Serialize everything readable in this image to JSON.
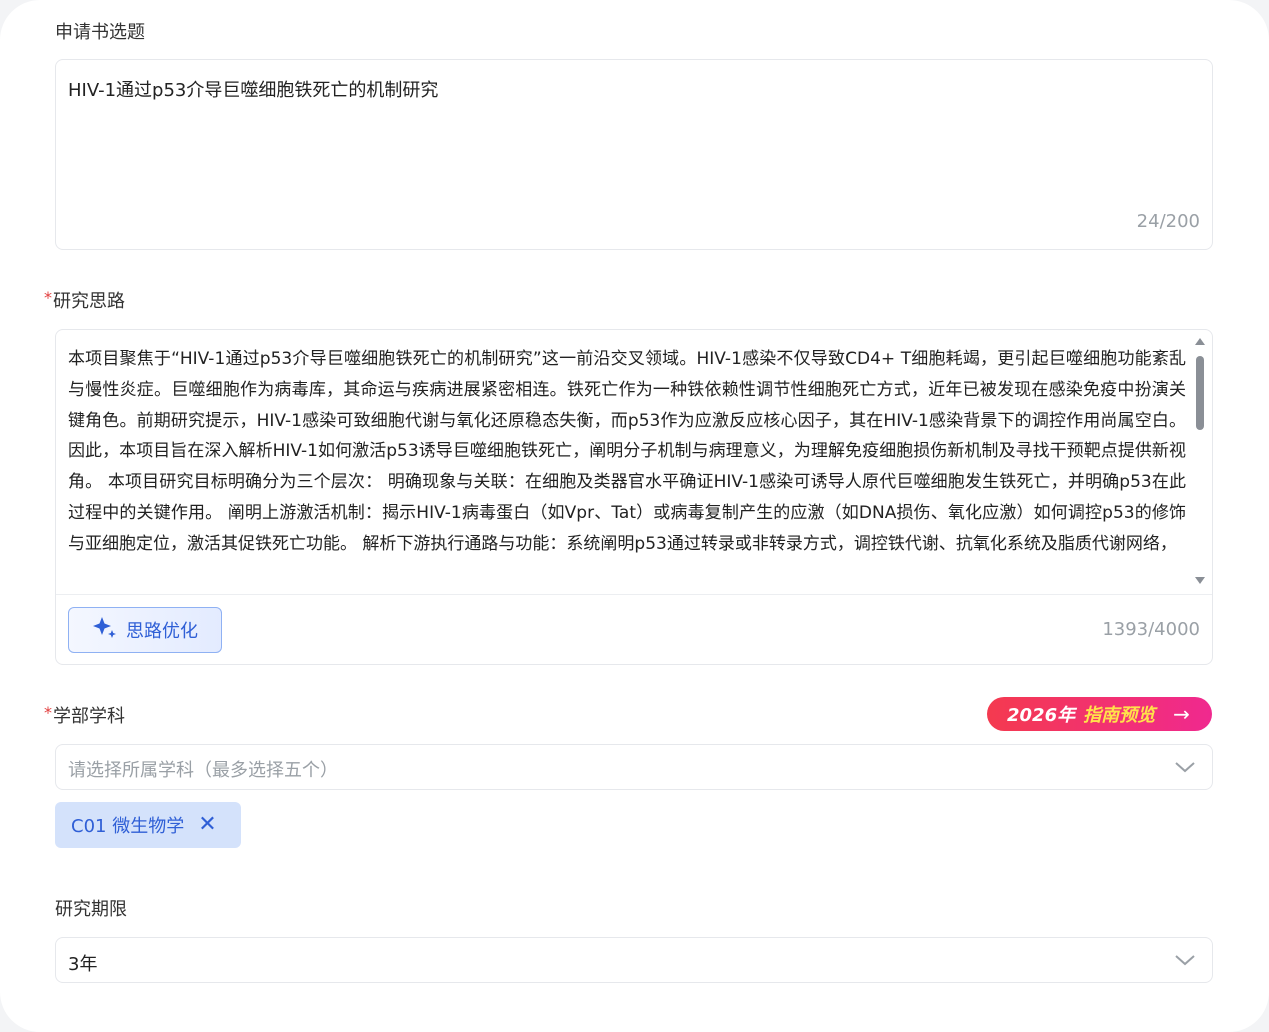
{
  "title_section": {
    "label": "申请书选题",
    "value": "HIV-1通过p53介导巨噬细胞铁死亡的机制研究",
    "counter": "24/200"
  },
  "research_idea": {
    "required_mark": "*",
    "label": "研究思路",
    "text": "本项目聚焦于“HIV-1通过p53介导巨噬细胞铁死亡的机制研究”这一前沿交叉领域。HIV-1感染不仅导致CD4+ T细胞耗竭，更引起巨噬细胞功能紊乱与慢性炎症。巨噬细胞作为病毒库，其命运与疾病进展紧密相连。铁死亡作为一种铁依赖性调节性细胞死亡方式，近年已被发现在感染免疫中扮演关键角色。前期研究提示，HIV-1感染可致细胞代谢与氧化还原稳态失衡，而p53作为应激反应核心因子，其在HIV-1感染背景下的调控作用尚属空白。因此，本项目旨在深入解析HIV-1如何激活p53诱导巨噬细胞铁死亡，阐明分子机制与病理意义，为理解免疫细胞损伤新机制及寻找干预靶点提供新视角。 本项目研究目标明确分为三个层次： 明确现象与关联：在细胞及类器官水平确证HIV-1感染可诱导人原代巨噬细胞发生铁死亡，并明确p53在此过程中的关键作用。 阐明上游激活机制：揭示HIV-1病毒蛋白（如Vpr、Tat）或病毒复制产生的应激（如DNA损伤、氧化应激）如何调控p53的修饰与亚细胞定位，激活其促铁死亡功能。 解析下游执行通路与功能：系统阐明p53通过转录或非转录方式，调控铁代谢、抗氧化系统及脂质代谢网络，",
    "optimize_button": "思路优化",
    "counter": "1393/4000"
  },
  "discipline": {
    "required_mark": "*",
    "label": "学部学科",
    "guide_button": {
      "year": "2026年",
      "text": "指南预览",
      "arrow": "→"
    },
    "placeholder": "请选择所属学科（最多选择五个）",
    "selected_tag": "C01 微生物学",
    "tag_remove": "✕"
  },
  "duration": {
    "label": "研究期限",
    "value": "3年"
  },
  "colors": {
    "accent": "#2f5fd6",
    "required": "#e23d3d",
    "guide_gradient_start": "#f43a4f",
    "guide_gradient_end": "#f0298f"
  },
  "icons": {
    "optimize": "sparkle-icon",
    "select": "chevron-down-icon",
    "tag_remove": "close-icon",
    "guide": "arrow-right-icon"
  }
}
